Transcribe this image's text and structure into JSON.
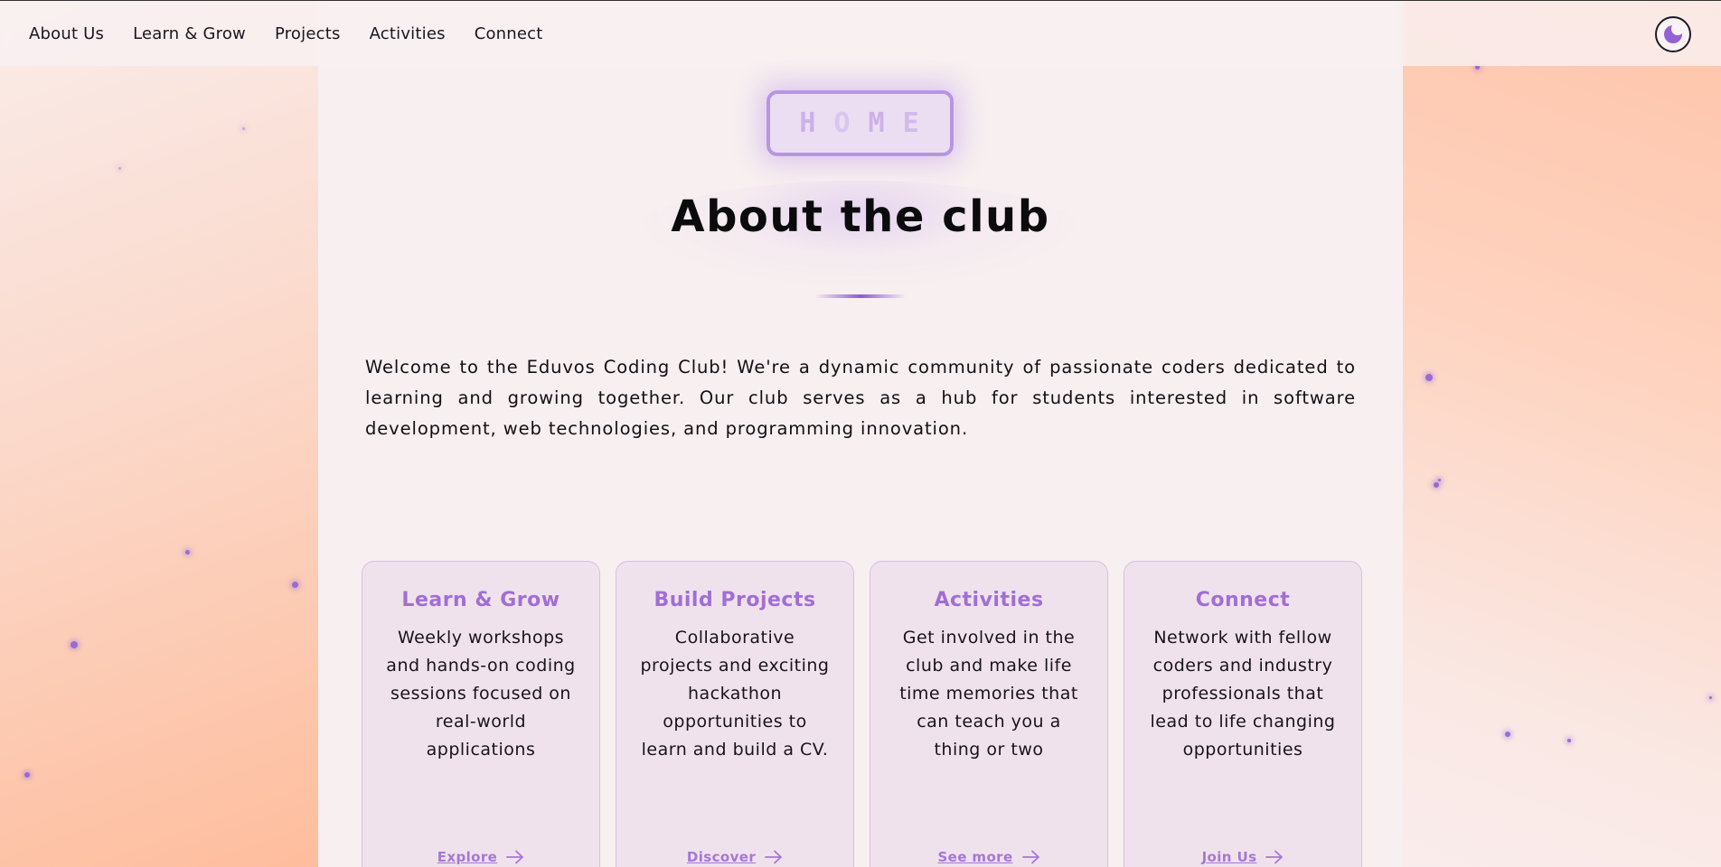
{
  "nav": {
    "items": [
      "About Us",
      "Learn & Grow",
      "Projects",
      "Activities",
      "Connect"
    ]
  },
  "theme_toggle": {
    "icon": "moon-icon"
  },
  "hero": {
    "badge_letters": [
      "H",
      "O",
      "M",
      "E"
    ],
    "title": "About the club",
    "intro": "Welcome to the Eduvos Coding Club! We're a dynamic community of passionate coders dedicated to learning and growing together. Our club serves as a hub for students interested in software development, web technologies, and programming innovation."
  },
  "cards": [
    {
      "title": "Learn & Grow",
      "text": "Weekly workshops and hands-on coding sessions focused on real-world applications",
      "link": "Explore"
    },
    {
      "title": "Build Projects",
      "text": "Collaborative projects and exciting hackathon opportunities to learn and build a CV.",
      "link": "Discover"
    },
    {
      "title": "Activities",
      "text": "Get involved in the club and make life time memories that can teach you a thing or two",
      "link": "See more"
    },
    {
      "title": "Connect",
      "text": "Network with fellow coders and industry professionals that lead to life changing opportunities",
      "link": "Join Us"
    }
  ],
  "colors": {
    "accent": "#9461d2",
    "card_title": "#a06fd4",
    "background": "#f7eff0",
    "side_gradient": "#febd9d"
  }
}
